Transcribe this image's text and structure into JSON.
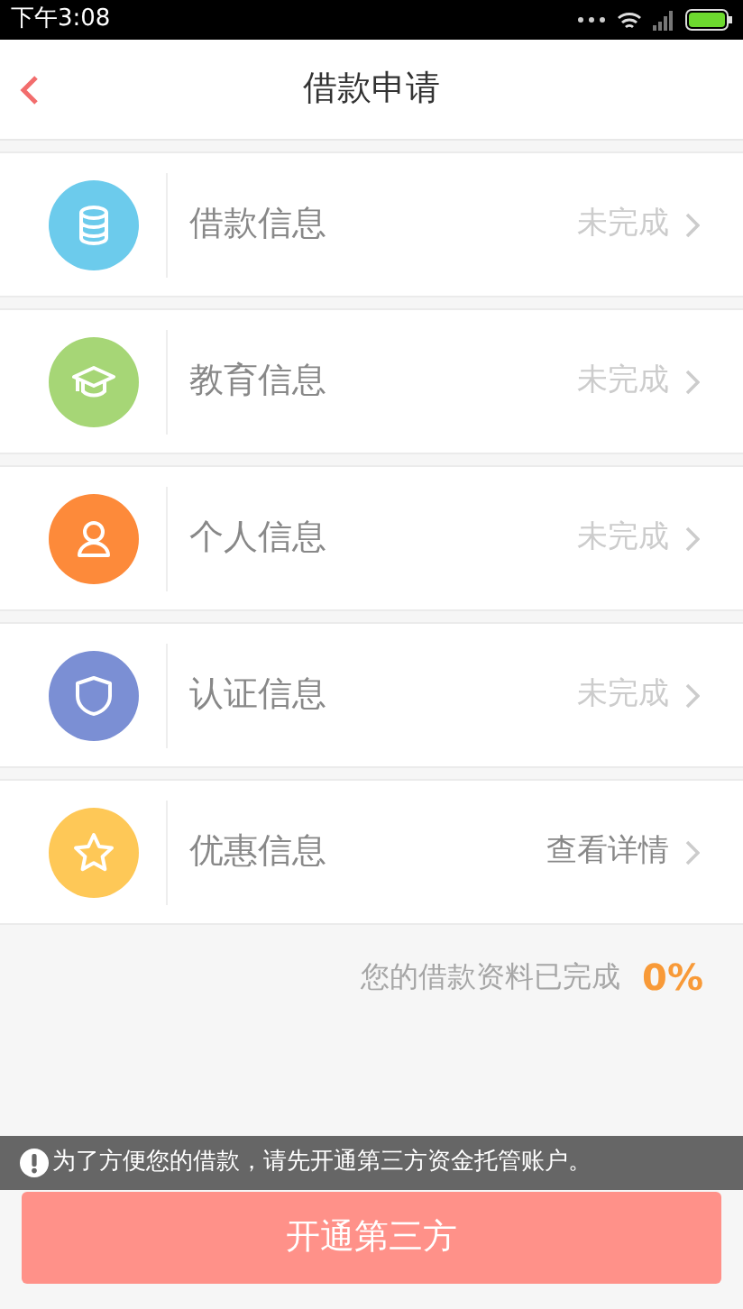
{
  "status_bar": {
    "time": "下午3:08"
  },
  "header": {
    "title": "借款申请"
  },
  "sections": [
    {
      "kind": "database",
      "color": "#6ccbec",
      "label": "借款信息",
      "status": "未完成",
      "emphasized": false
    },
    {
      "kind": "cap",
      "color": "#a6d676",
      "label": "教育信息",
      "status": "未完成",
      "emphasized": false
    },
    {
      "kind": "person",
      "color": "#fd8a3a",
      "label": "个人信息",
      "status": "未完成",
      "emphasized": false
    },
    {
      "kind": "shield",
      "color": "#7b8fd4",
      "label": "认证信息",
      "status": "未完成",
      "emphasized": false
    },
    {
      "kind": "star",
      "color": "#fec857",
      "label": "优惠信息",
      "status": "查看详情",
      "emphasized": true
    }
  ],
  "progress": {
    "label": "您的借款资料已完成",
    "value": "0%"
  },
  "notice": {
    "text": "为了方便您的借款，请先开通第三方资金托管账户。"
  },
  "button": {
    "label": "开通第三方"
  }
}
